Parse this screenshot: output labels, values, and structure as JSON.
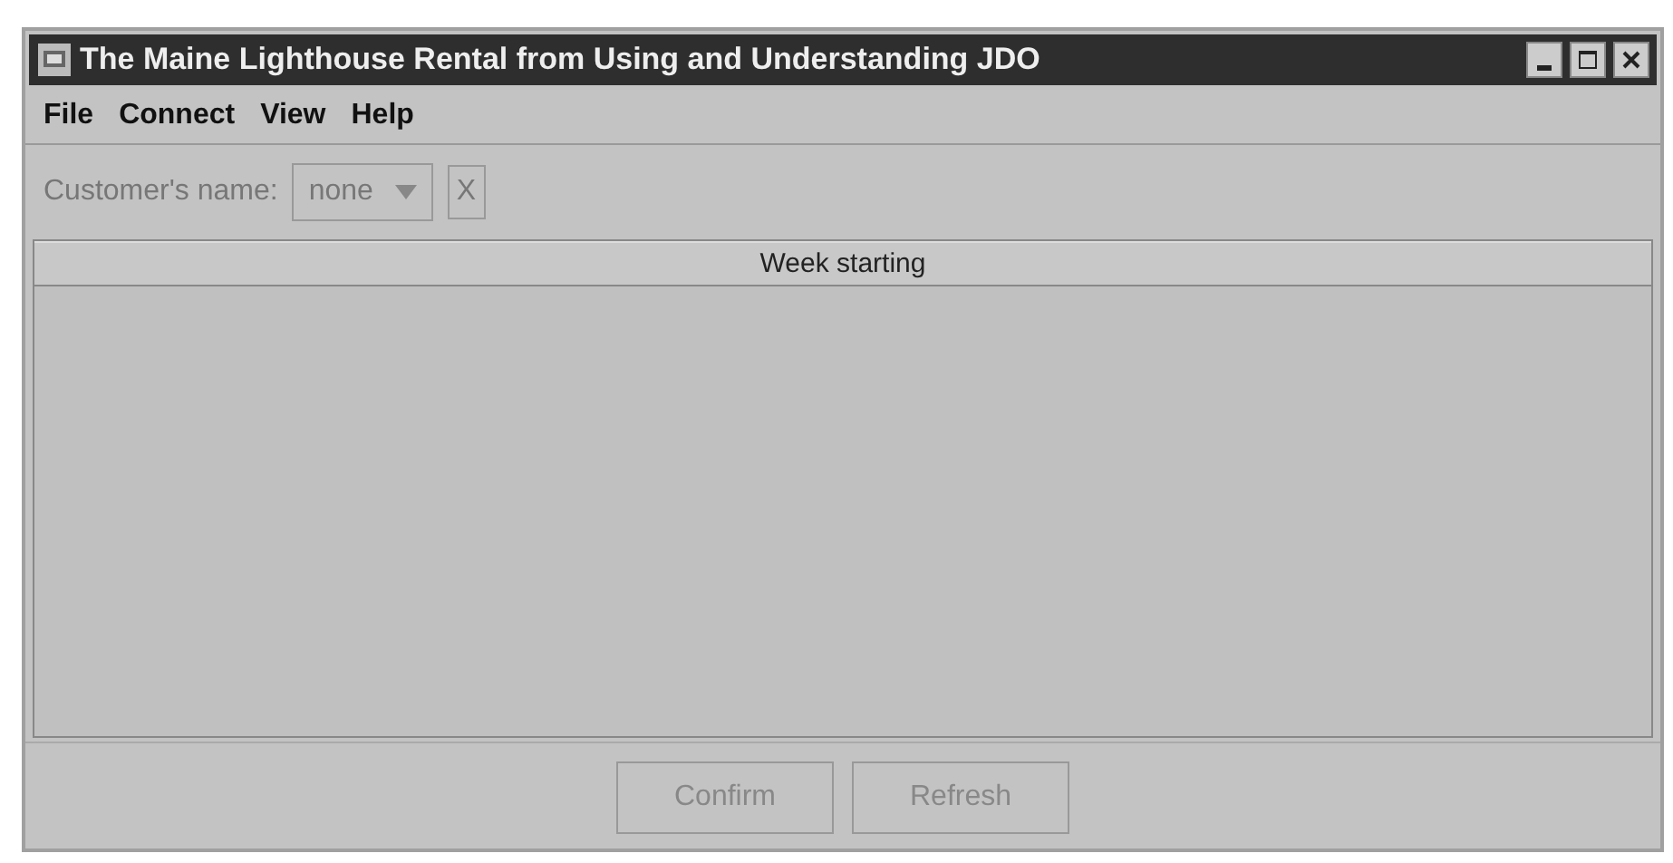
{
  "window": {
    "title": "The Maine Lighthouse Rental from Using and Understanding JDO"
  },
  "menu": [
    "File",
    "Connect",
    "View",
    "Help"
  ],
  "toolbar": {
    "label": "Customer's name:",
    "combo": {
      "value": "none",
      "disabled": true
    },
    "clear_button": {
      "label": "X",
      "disabled": true
    }
  },
  "table": {
    "columns": [
      "Week starting"
    ]
  },
  "buttons": [
    {
      "label": "Confirm",
      "disabled": true
    },
    {
      "label": "Refresh",
      "disabled": true
    }
  ]
}
